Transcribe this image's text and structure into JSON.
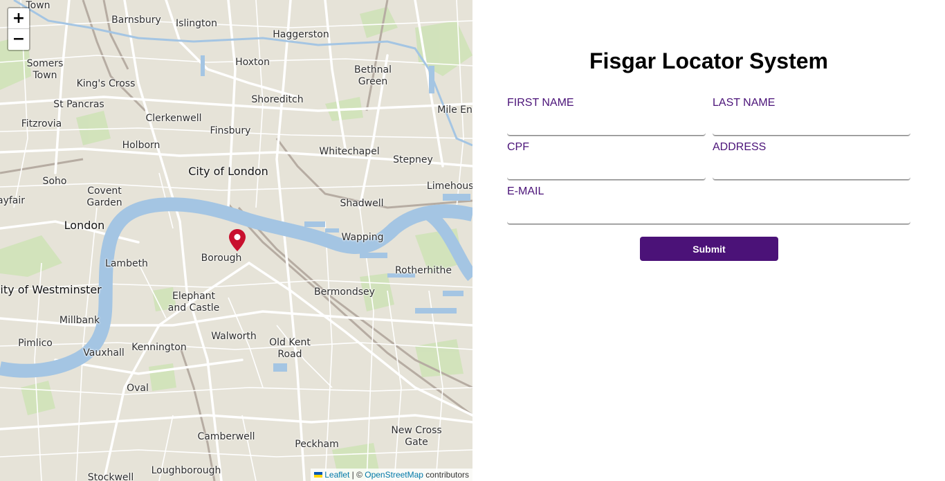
{
  "map": {
    "zoom_in_label": "+",
    "zoom_out_label": "−",
    "attribution": {
      "leaflet": "Leaflet",
      "separator": " | © ",
      "osm": "OpenStreetMap",
      "contributors": " contributors"
    },
    "places": [
      {
        "name": "Town"
      },
      {
        "name": "Barnsbury"
      },
      {
        "name": "Islington"
      },
      {
        "name": "Haggerston"
      },
      {
        "name": "Somers\nTown"
      },
      {
        "name": "King's Cross"
      },
      {
        "name": "Hoxton"
      },
      {
        "name": "Bethnal\nGreen"
      },
      {
        "name": "St Pancras"
      },
      {
        "name": "Shoreditch"
      },
      {
        "name": "Mile End"
      },
      {
        "name": "Fitzrovia"
      },
      {
        "name": "Clerkenwell"
      },
      {
        "name": "Finsbury"
      },
      {
        "name": "Holborn"
      },
      {
        "name": "Whitechapel"
      },
      {
        "name": "Stepney"
      },
      {
        "name": "City of London"
      },
      {
        "name": "Soho"
      },
      {
        "name": "Covent\nGarden"
      },
      {
        "name": "Limehouse"
      },
      {
        "name": "ayfair"
      },
      {
        "name": "Shadwell"
      },
      {
        "name": "London"
      },
      {
        "name": "Wapping"
      },
      {
        "name": "Borough"
      },
      {
        "name": "Lambeth"
      },
      {
        "name": "Rotherhithe"
      },
      {
        "name": "City of Westminster"
      },
      {
        "name": "Bermondsey"
      },
      {
        "name": "Elephant\nand Castle"
      },
      {
        "name": "Millbank"
      },
      {
        "name": "Walworth"
      },
      {
        "name": "Old Kent\nRoad"
      },
      {
        "name": "Pimlico"
      },
      {
        "name": "Kennington"
      },
      {
        "name": "Vauxhall"
      },
      {
        "name": "Oval"
      },
      {
        "name": "New Cross\nGate"
      },
      {
        "name": "Camberwell"
      },
      {
        "name": "Peckham"
      },
      {
        "name": "Loughborough"
      },
      {
        "name": "Stockwell"
      }
    ],
    "marker_icon": "map-pin-icon"
  },
  "form": {
    "title": "Fisgar Locator System",
    "first_name_label": "FIRST NAME",
    "first_name_value": "",
    "last_name_label": "LAST NAME",
    "last_name_value": "",
    "cpf_label": "CPF",
    "cpf_value": "",
    "address_label": "ADDRESS",
    "address_value": "",
    "email_label": "E-MAIL",
    "email_value": "",
    "submit_label": "Submit"
  },
  "colors": {
    "accent": "#4b1278",
    "label": "#4a1278",
    "river": "#a4c5e3",
    "marker": "#c8102e",
    "map_land": "#e6e3d8",
    "map_park": "#cfe2b8"
  }
}
